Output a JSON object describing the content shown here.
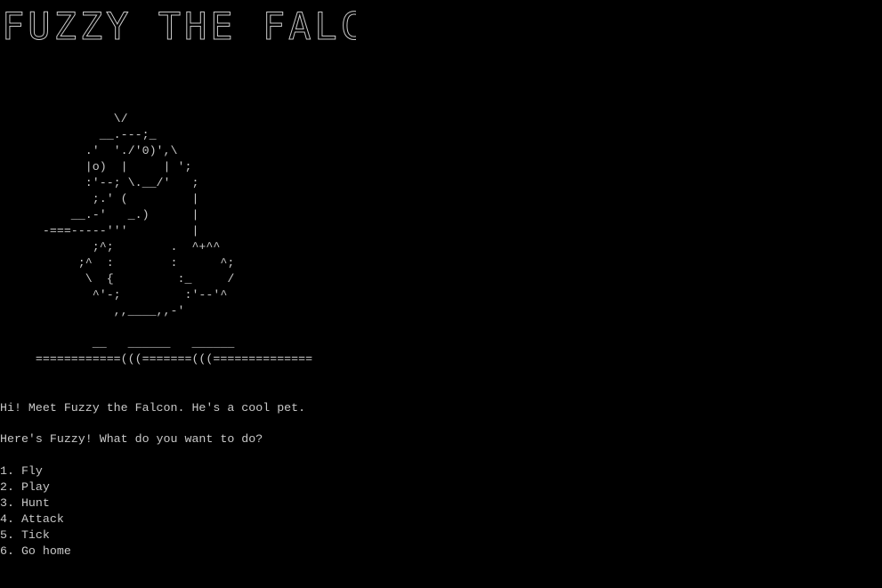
{
  "app": {
    "title_banner": "FUZZY THE FALCON"
  },
  "ascii_art": {
    "falcon": "                \\/\n              __.---;_\n            .'  './'0)',\\\n            |o)  |     | ';\n            :'--; \\.__/'   ;\n             ;.' (         |\n          __.-'   _.)      |\n      -===-----'''         |\n             ;^;        .  ^+^^\n           ;^  :        :      ^;\n            \\  {         :_     /\n             ^'-;         :'--'^\n                ,,____,,-'\n\n             __   ______   ______\n     ============(((=======(((=============="
  },
  "messages": {
    "greeting": "Hi! Meet Fuzzy the Falcon. He's a cool pet.",
    "prompt": "Here's Fuzzy! What do you want to do?"
  },
  "menu": {
    "items": [
      {
        "label": "1. Fly"
      },
      {
        "label": "2. Play"
      },
      {
        "label": "3. Hunt"
      },
      {
        "label": "4. Attack"
      },
      {
        "label": "5. Tick"
      },
      {
        "label": "6. Go home"
      }
    ]
  },
  "colors": {
    "background": "#000000",
    "text": "#c8c8c8"
  }
}
